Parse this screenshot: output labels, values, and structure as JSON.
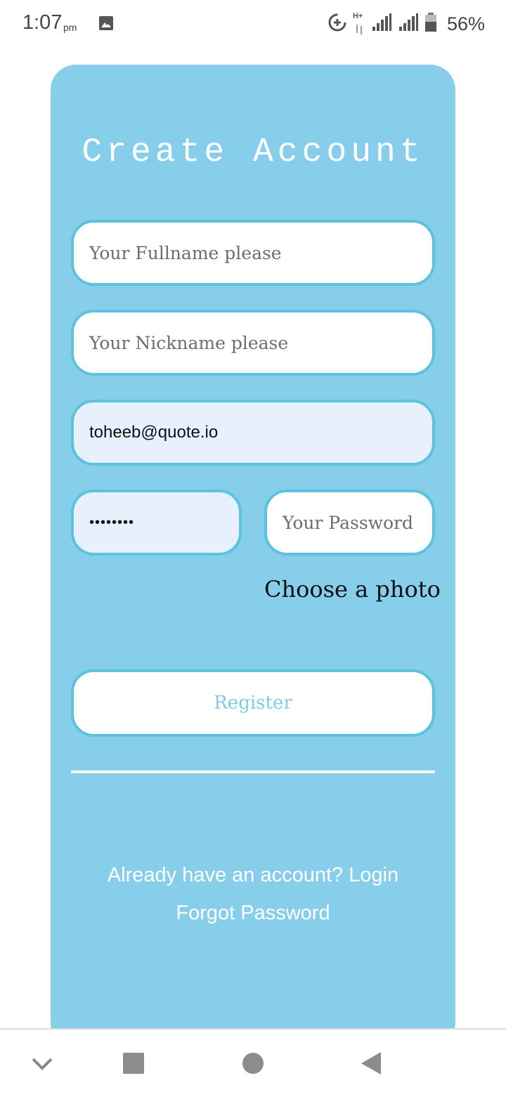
{
  "status_bar": {
    "time": "1:07",
    "ampm": "pm",
    "network_label": "H+",
    "battery": "56%"
  },
  "form": {
    "title": "Create Account",
    "fullname_placeholder": "Your Fullname please",
    "nickname_placeholder": "Your Nickname please",
    "email_value": "toheeb@quote.io",
    "password_value": "••••••••",
    "confirm_password_placeholder": "Your Password",
    "photo_label": "Choose a photo",
    "register_label": "Register",
    "login_link": "Already have an account? Login",
    "forgot_link": "Forgot Password"
  },
  "colors": {
    "card_background": "#87ceea",
    "field_border": "#5bc3dd",
    "filled_field_background": "#e8f0fe"
  },
  "nav_bar": {
    "icons": [
      "chevron-down-icon",
      "recents-square-icon",
      "home-circle-icon",
      "back-triangle-icon"
    ]
  }
}
